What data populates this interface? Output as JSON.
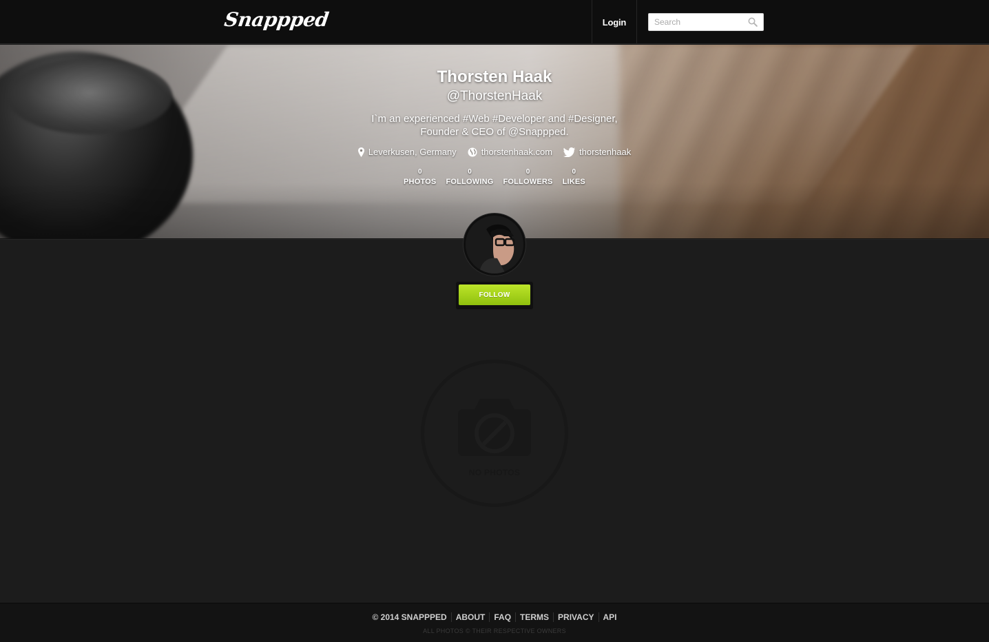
{
  "header": {
    "logo": "Snappped",
    "login_label": "Login",
    "search_placeholder": "Search"
  },
  "profile": {
    "name": "Thorsten Haak",
    "handle": "@ThorstenHaak",
    "bio_line1": "I`m an experienced #Web #Developer and #Designer,",
    "bio_line2": "Founder & CEO of @Snappped.",
    "location": "Leverkusen, Germany",
    "website": "thorstenhaak.com",
    "twitter": "thorstenhaak",
    "stats": [
      {
        "value": "0",
        "label": "PHOTOS"
      },
      {
        "value": "0",
        "label": "FOLLOWING"
      },
      {
        "value": "0",
        "label": "FOLLOWERS"
      },
      {
        "value": "0",
        "label": "LIKES"
      }
    ],
    "follow_label": "FOLLOW"
  },
  "empty_state": {
    "label": "NO PHOTOS"
  },
  "footer": {
    "copyright": "© 2014 SNAPPPED",
    "links": [
      "ABOUT",
      "FAQ",
      "TERMS",
      "PRIVACY",
      "API"
    ],
    "note": "ALL PHOTOS © THEIR RESPECTIVE OWNERS"
  },
  "colors": {
    "accent": "#9bcc14",
    "topbar": "#0e0e0e",
    "background": "#1c1c1c"
  }
}
